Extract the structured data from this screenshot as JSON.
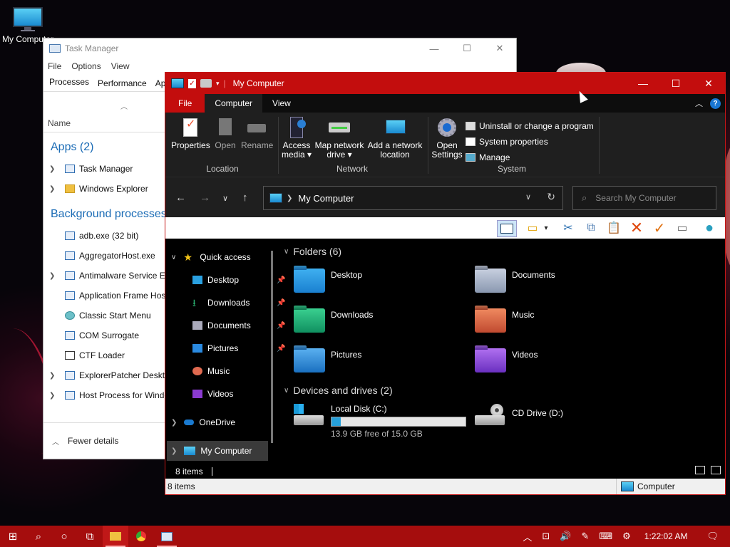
{
  "desktop": {
    "icon_label": "My Computer"
  },
  "task_manager": {
    "title": "Task Manager",
    "menu": [
      "File",
      "Options",
      "View"
    ],
    "tabs": [
      "Processes",
      "Performance",
      "App"
    ],
    "column_name": "Name",
    "apps_group": "Apps (2)",
    "apps": [
      "Task Manager",
      "Windows Explorer"
    ],
    "bg_group": "Background processes",
    "bg_processes": [
      "adb.exe (32 bit)",
      "AggregatorHost.exe",
      "Antimalware Service Ex",
      "Application Frame Hos",
      "Classic Start Menu",
      "COM Surrogate",
      "CTF Loader",
      "ExplorerPatcher Deskto",
      "Host Process for Windo"
    ],
    "fewer_details": "Fewer details"
  },
  "explorer": {
    "title": "My Computer",
    "tabs": {
      "file": "File",
      "computer": "Computer",
      "view": "View"
    },
    "ribbon": {
      "properties": "Properties",
      "open": "Open",
      "rename": "Rename",
      "access_media_1": "Access",
      "access_media_2": "media ▾",
      "map_network_1": "Map network",
      "map_network_2": "drive ▾",
      "add_network_1": "Add a network",
      "add_network_2": "location",
      "open_settings_1": "Open",
      "open_settings_2": "Settings",
      "uninstall": "Uninstall or change a program",
      "system_properties": "System properties",
      "manage": "Manage",
      "group_location": "Location",
      "group_network": "Network",
      "group_system": "System"
    },
    "address": "My Computer",
    "search_placeholder": "Search My Computer",
    "nav": {
      "quick_access": "Quick access",
      "items": [
        "Desktop",
        "Downloads",
        "Documents",
        "Pictures",
        "Music",
        "Videos"
      ],
      "onedrive": "OneDrive",
      "my_computer": "My Computer"
    },
    "folders_header": "Folders (6)",
    "folders": [
      "Desktop",
      "Documents",
      "Downloads",
      "Music",
      "Pictures",
      "Videos"
    ],
    "devices_header": "Devices and drives (2)",
    "drives": {
      "local_name": "Local Disk (C:)",
      "local_free": "13.9 GB free of 15.0 GB",
      "local_used_fraction": 0.07,
      "cd_name": "CD Drive (D:)"
    },
    "item_count": "8 items",
    "status_count": "8 items",
    "status_location": "Computer"
  },
  "taskbar": {
    "clock": "1:22:02 AM"
  }
}
